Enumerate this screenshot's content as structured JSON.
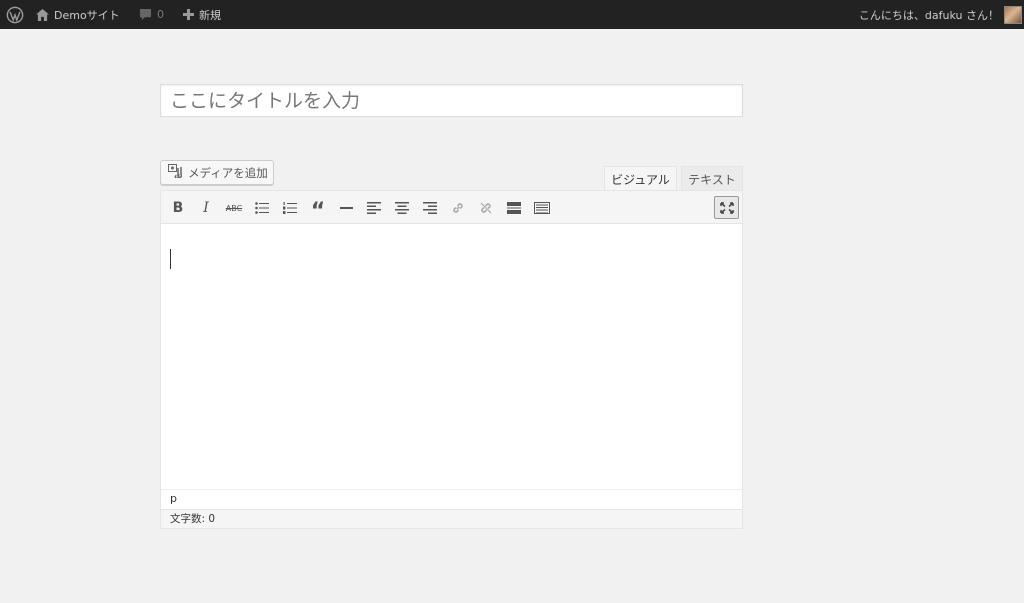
{
  "admin_bar": {
    "wp_icon": "wordpress-logo-icon",
    "site_icon": "home-icon",
    "site_name": "Demoサイト",
    "comments_icon": "comment-bubble-icon",
    "comments_count": "0",
    "new_icon": "plus-icon",
    "new_label": "新規",
    "greeting": "こんにちは、dafuku さん！"
  },
  "post": {
    "title_placeholder": "ここにタイトルを入力",
    "title_value": ""
  },
  "media": {
    "add_media_label": "メディアを追加",
    "icon": "add-media-icon"
  },
  "editor": {
    "tabs": [
      {
        "label": "ビジュアル",
        "active": true
      },
      {
        "label": "テキスト",
        "active": false
      }
    ],
    "toolbar": {
      "bold": "B",
      "italic": "I",
      "strikethrough": "ABC",
      "quote": "“",
      "icons": [
        "bold-icon",
        "italic-icon",
        "strikethrough-icon",
        "bulleted-list-icon",
        "numbered-list-icon",
        "blockquote-icon",
        "horizontal-rule-icon",
        "align-left-icon",
        "align-center-icon",
        "align-right-icon",
        "link-icon",
        "unlink-icon",
        "read-more-icon",
        "toolbar-toggle-icon",
        "fullscreen-icon"
      ]
    },
    "content": "",
    "path": "p",
    "word_count_label": "文字数: 0"
  },
  "colors": {
    "admin_bar_bg": "#222222",
    "page_bg": "#f1f1f1"
  }
}
